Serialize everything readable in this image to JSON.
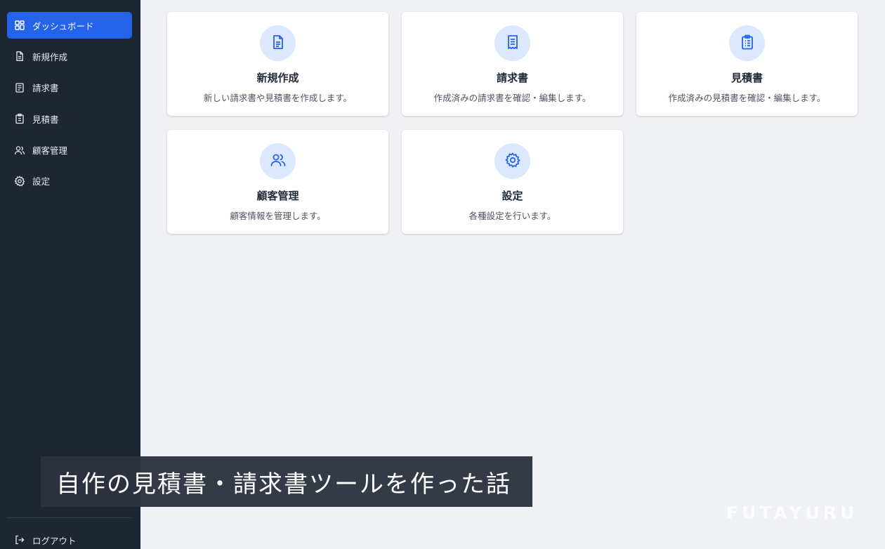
{
  "sidebar": {
    "items": [
      {
        "label": "ダッシュボード",
        "icon": "dashboard-icon",
        "active": true
      },
      {
        "label": "新規作成",
        "icon": "document-icon"
      },
      {
        "label": "請求書",
        "icon": "receipt-icon"
      },
      {
        "label": "見積書",
        "icon": "clipboard-icon"
      },
      {
        "label": "顧客管理",
        "icon": "users-icon"
      },
      {
        "label": "設定",
        "icon": "gear-icon"
      }
    ],
    "logout_label": "ログアウト"
  },
  "cards": [
    {
      "title": "新規作成",
      "description": "新しい請求書や見積書を作成します。",
      "icon": "document-icon"
    },
    {
      "title": "請求書",
      "description": "作成済みの請求書を確認・編集します。",
      "icon": "receipt-icon"
    },
    {
      "title": "見積書",
      "description": "作成済みの見積書を確認・編集します。",
      "icon": "clipboard-icon"
    },
    {
      "title": "顧客管理",
      "description": "顧客情報を管理します。",
      "icon": "users-icon"
    },
    {
      "title": "設定",
      "description": "各種設定を行います。",
      "icon": "gear-icon"
    }
  ],
  "caption": "自作の見積書・請求書ツールを作った話",
  "watermark": "FUTAYURU",
  "colors": {
    "sidebar_bg": "#1e2533",
    "accent": "#2563eb",
    "page_bg": "#eff1f5",
    "icon_circle": "#dbe8fd"
  }
}
